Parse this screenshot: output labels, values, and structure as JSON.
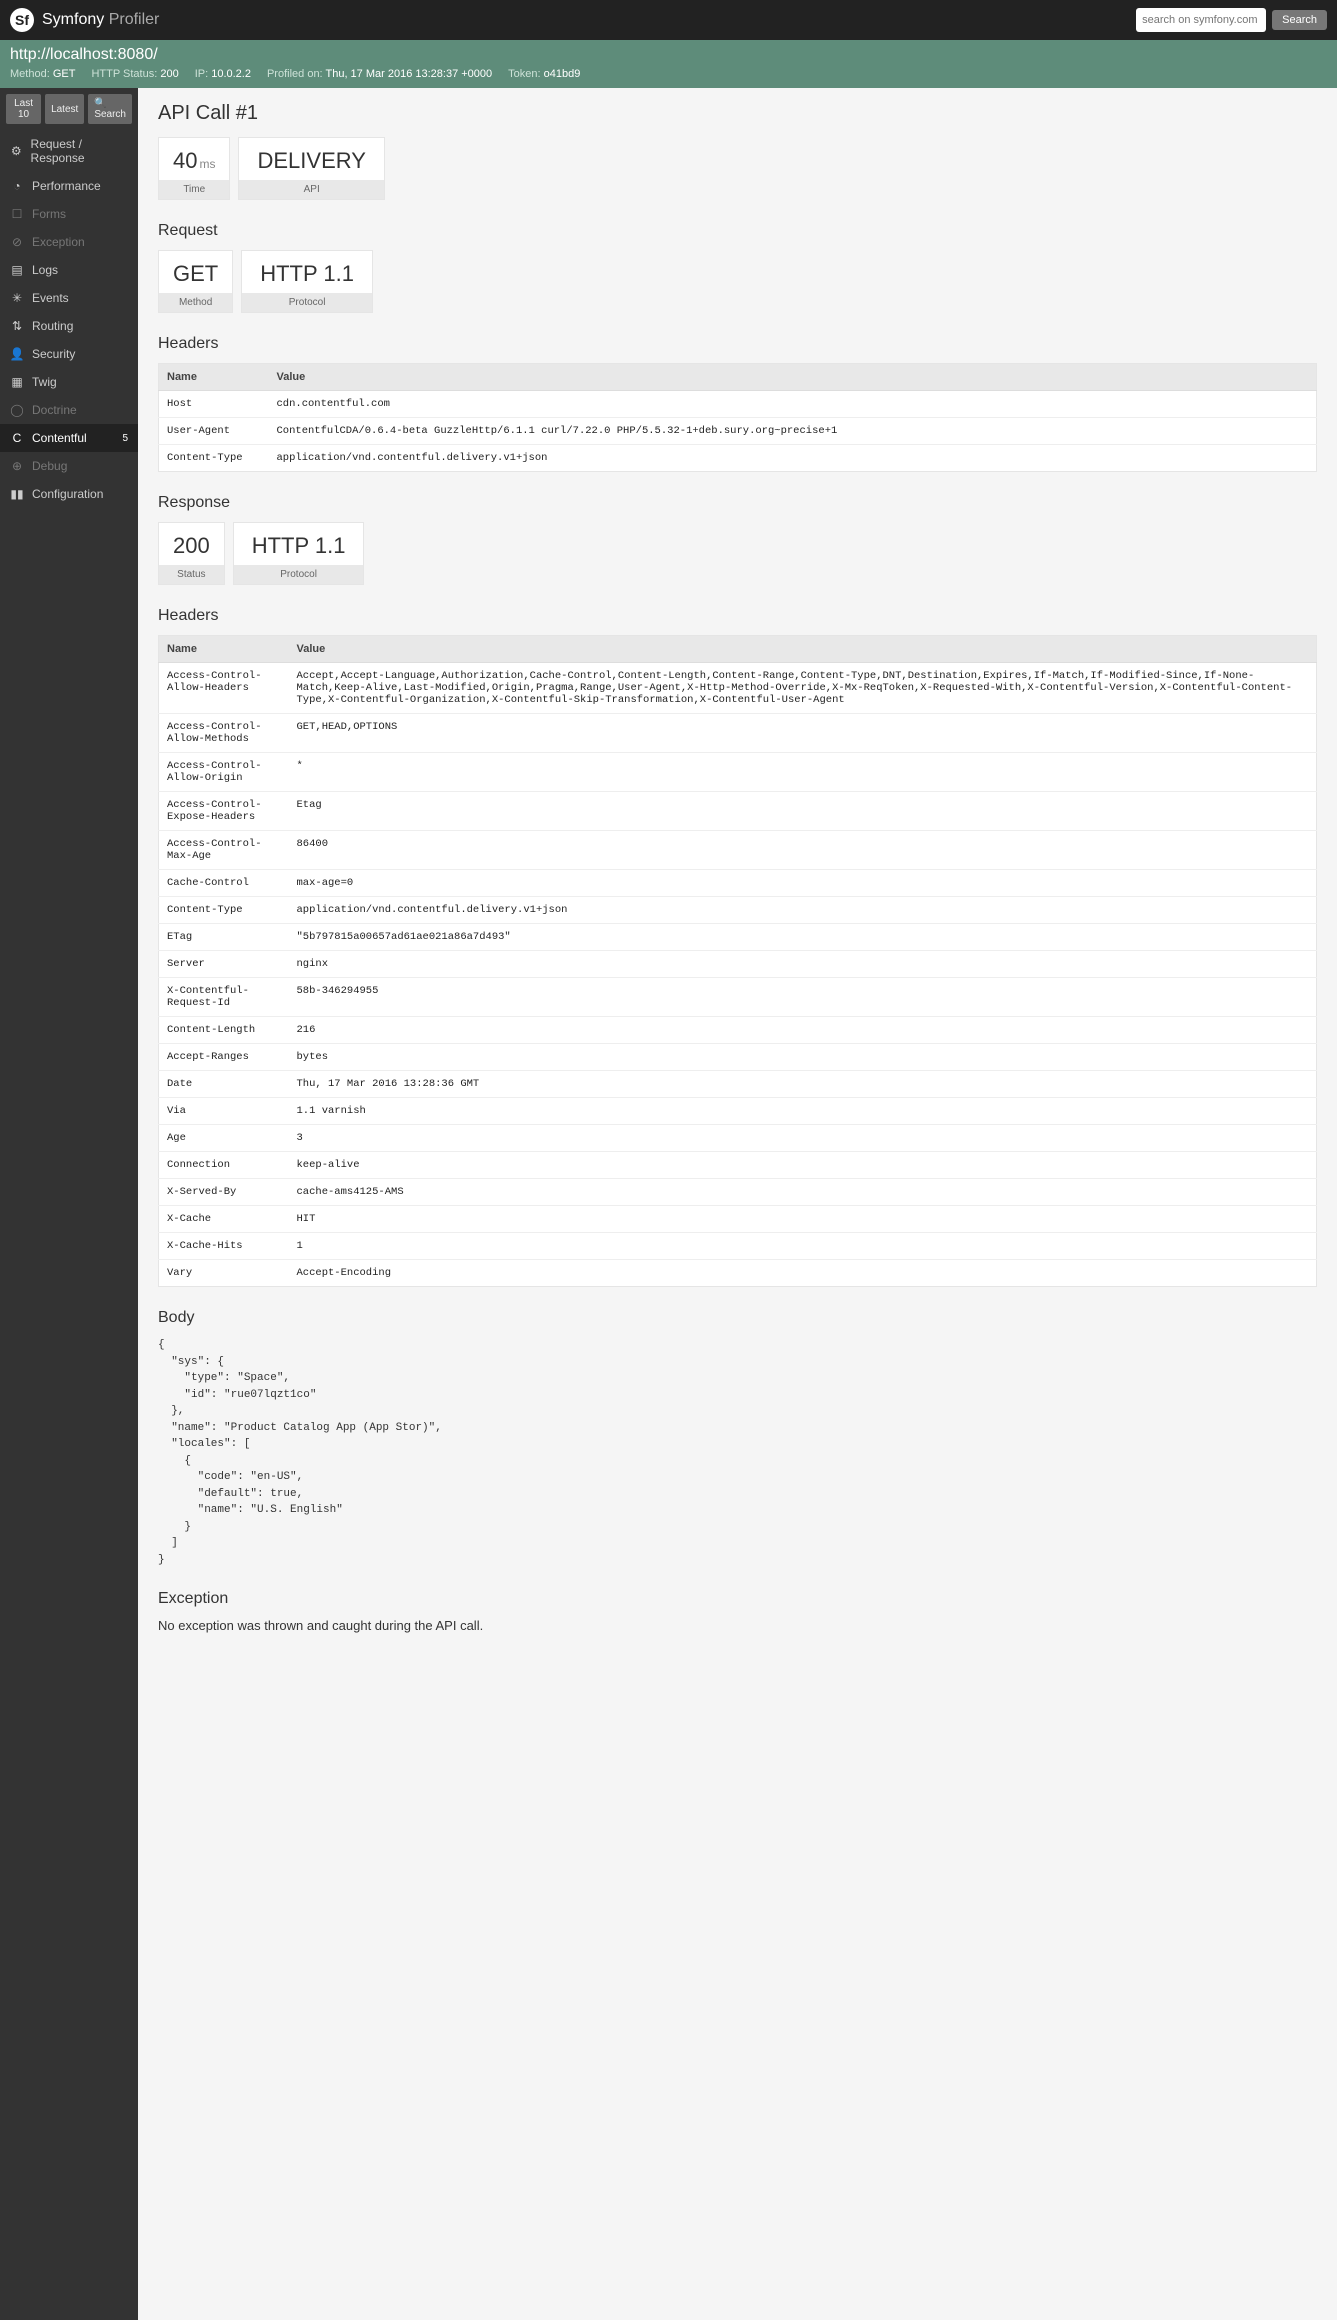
{
  "topbar": {
    "brand_main": "Symfony",
    "brand_sub": "Profiler",
    "search_placeholder": "search on symfony.com",
    "search_button": "Search"
  },
  "summary": {
    "url": "http://localhost:8080/",
    "method_label": "Method:",
    "method": "GET",
    "status_label": "HTTP Status:",
    "status": "200",
    "ip_label": "IP:",
    "ip": "10.0.2.2",
    "profiled_label": "Profiled on:",
    "profiled": "Thu, 17 Mar 2016 13:28:37 +0000",
    "token_label": "Token:",
    "token": "o41bd9"
  },
  "sidebar_controls": {
    "last10": "Last 10",
    "latest": "Latest",
    "search": "Search"
  },
  "nav": [
    {
      "label": "Request / Response",
      "icon": "⚙",
      "muted": false
    },
    {
      "label": "Performance",
      "icon": "◔",
      "muted": false
    },
    {
      "label": "Forms",
      "icon": "☐",
      "muted": true
    },
    {
      "label": "Exception",
      "icon": "⊘",
      "muted": true
    },
    {
      "label": "Logs",
      "icon": "▤",
      "muted": false
    },
    {
      "label": "Events",
      "icon": "✳",
      "muted": false
    },
    {
      "label": "Routing",
      "icon": "⇅",
      "muted": false
    },
    {
      "label": "Security",
      "icon": "👤",
      "muted": false
    },
    {
      "label": "Twig",
      "icon": "▦",
      "muted": false
    },
    {
      "label": "Doctrine",
      "icon": "◯",
      "muted": true
    },
    {
      "label": "Contentful",
      "icon": "C",
      "muted": false,
      "active": true,
      "badge": "5"
    },
    {
      "label": "Debug",
      "icon": "⊕",
      "muted": true
    },
    {
      "label": "Configuration",
      "icon": "▮▮",
      "muted": false
    }
  ],
  "page": {
    "title": "API Call #1",
    "time_val": "40",
    "time_unit": "ms",
    "time_label": "Time",
    "api_val": "DELIVERY",
    "api_label": "API",
    "request_heading": "Request",
    "req_method_val": "GET",
    "req_method_label": "Method",
    "req_proto_val": "HTTP 1.1",
    "req_proto_label": "Protocol",
    "headers_heading": "Headers",
    "th_name": "Name",
    "th_value": "Value",
    "req_headers": [
      {
        "name": "Host",
        "value": "cdn.contentful.com"
      },
      {
        "name": "User-Agent",
        "value": "ContentfulCDA/0.6.4-beta GuzzleHttp/6.1.1 curl/7.22.0 PHP/5.5.32-1+deb.sury.org~precise+1"
      },
      {
        "name": "Content-Type",
        "value": "application/vnd.contentful.delivery.v1+json"
      }
    ],
    "response_heading": "Response",
    "resp_status_val": "200",
    "resp_status_label": "Status",
    "resp_proto_val": "HTTP 1.1",
    "resp_proto_label": "Protocol",
    "resp_headers": [
      {
        "name": "Access-Control-Allow-Headers",
        "value": "Accept,Accept-Language,Authorization,Cache-Control,Content-Length,Content-Range,Content-Type,DNT,Destination,Expires,If-Match,If-Modified-Since,If-None-Match,Keep-Alive,Last-Modified,Origin,Pragma,Range,User-Agent,X-Http-Method-Override,X-Mx-ReqToken,X-Requested-With,X-Contentful-Version,X-Contentful-Content-Type,X-Contentful-Organization,X-Contentful-Skip-Transformation,X-Contentful-User-Agent"
      },
      {
        "name": "Access-Control-Allow-Methods",
        "value": "GET,HEAD,OPTIONS"
      },
      {
        "name": "Access-Control-Allow-Origin",
        "value": "*"
      },
      {
        "name": "Access-Control-Expose-Headers",
        "value": "Etag"
      },
      {
        "name": "Access-Control-Max-Age",
        "value": "86400"
      },
      {
        "name": "Cache-Control",
        "value": "max-age=0"
      },
      {
        "name": "Content-Type",
        "value": "application/vnd.contentful.delivery.v1+json"
      },
      {
        "name": "ETag",
        "value": "\"5b797815a00657ad61ae021a86a7d493\""
      },
      {
        "name": "Server",
        "value": "nginx"
      },
      {
        "name": "X-Contentful-Request-Id",
        "value": "58b-346294955"
      },
      {
        "name": "Content-Length",
        "value": "216"
      },
      {
        "name": "Accept-Ranges",
        "value": "bytes"
      },
      {
        "name": "Date",
        "value": "Thu, 17 Mar 2016 13:28:36 GMT"
      },
      {
        "name": "Via",
        "value": "1.1 varnish"
      },
      {
        "name": "Age",
        "value": "3"
      },
      {
        "name": "Connection",
        "value": "keep-alive"
      },
      {
        "name": "X-Served-By",
        "value": "cache-ams4125-AMS"
      },
      {
        "name": "X-Cache",
        "value": "HIT"
      },
      {
        "name": "X-Cache-Hits",
        "value": "1"
      },
      {
        "name": "Vary",
        "value": "Accept-Encoding"
      }
    ],
    "body_heading": "Body",
    "body_text": "{\n  \"sys\": {\n    \"type\": \"Space\",\n    \"id\": \"rue07lqzt1co\"\n  },\n  \"name\": \"Product Catalog App (App Stor)\",\n  \"locales\": [\n    {\n      \"code\": \"en-US\",\n      \"default\": true,\n      \"name\": \"U.S. English\"\n    }\n  ]\n}",
    "exception_heading": "Exception",
    "exception_text": "No exception was thrown and caught during the API call."
  }
}
